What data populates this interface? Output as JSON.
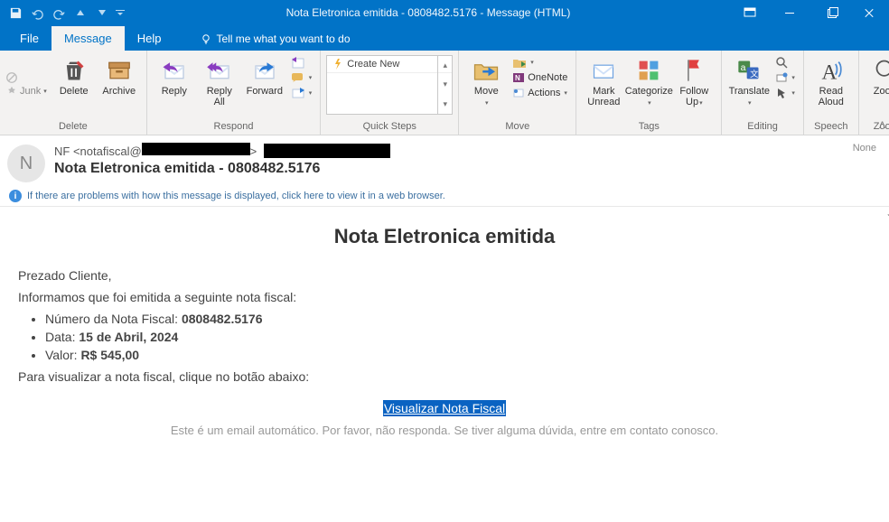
{
  "titlebar": {
    "title": "Nota Eletronica emitida - 0808482.5176  -  Message (HTML)"
  },
  "menu": {
    "file": "File",
    "message": "Message",
    "help": "Help",
    "tell_me": "Tell me what you want to do"
  },
  "ribbon": {
    "junk": "Junk",
    "delete": "Delete",
    "archive": "Archive",
    "reply": "Reply",
    "reply_all": "Reply\nAll",
    "forward": "Forward",
    "more": " ",
    "create_new": "Create New",
    "move": "Move",
    "onenote": "OneNote",
    "actions": "Actions",
    "mark_unread": "Mark\nUnread",
    "categorize": "Categorize",
    "follow_up": "Follow\nUp",
    "translate": "Translate",
    "read_aloud": "Read\nAloud",
    "zoom": "Zoom",
    "group_delete": "Delete",
    "group_respond": "Respond",
    "group_quicksteps": "Quick Steps",
    "group_move": "Move",
    "group_tags": "Tags",
    "group_editing": "Editing",
    "group_speech": "Speech",
    "group_zoom": "Zoom"
  },
  "header": {
    "avatar_initial": "N",
    "from_prefix": "NF <notafiscal@",
    "from_suffix": ">",
    "subject": "Nota Eletronica emitida - 0808482.5176",
    "none": "None",
    "infobar": "If there are problems with how this message is displayed, click here to view it in a web browser."
  },
  "body": {
    "title": "Nota Eletronica emitida",
    "greeting": "Prezado Cliente,",
    "intro": "Informamos que foi emitida a seguinte nota fiscal:",
    "li1_label": "Número da Nota Fiscal: ",
    "li1_value": "0808482.5176",
    "li2_label": "Data: ",
    "li2_value": "15 de Abril, 2024",
    "li3_label": "Valor: ",
    "li3_value": "R$ 545,00",
    "cta_text": "Para visualizar a nota fiscal, clique no botão abaixo:",
    "link": "Visualizar Nota Fiscal",
    "footer": "Este é um email automático. Por favor, não responda. Se tiver alguma dúvida, entre em contato conosco."
  }
}
